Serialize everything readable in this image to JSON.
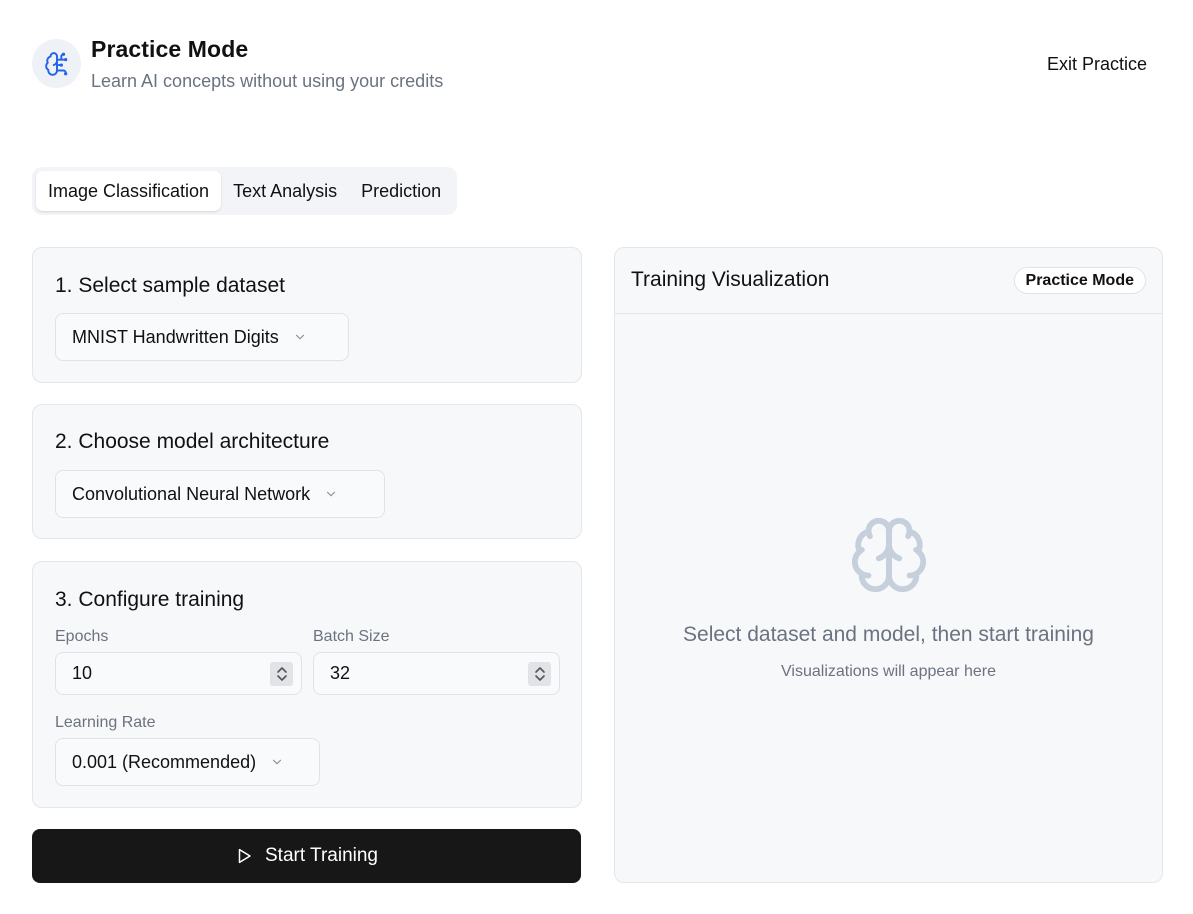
{
  "header": {
    "title": "Practice Mode",
    "subtitle": "Learn AI concepts without using your credits",
    "exit_label": "Exit Practice",
    "logo_icon": "brain-circuit-icon"
  },
  "tabs": [
    {
      "label": "Image Classification",
      "active": true
    },
    {
      "label": "Text Analysis",
      "active": false
    },
    {
      "label": "Prediction",
      "active": false
    }
  ],
  "dataset": {
    "title": "1. Select sample dataset",
    "selected": "MNIST Handwritten Digits"
  },
  "model": {
    "title": "2. Choose model architecture",
    "selected": "Convolutional Neural Network"
  },
  "training": {
    "title": "3. Configure training",
    "epochs_label": "Epochs",
    "epochs_value": "10",
    "batch_label": "Batch Size",
    "batch_value": "32",
    "lr_label": "Learning Rate",
    "lr_selected": "0.001 (Recommended)"
  },
  "start_button": {
    "label": "Start Training",
    "icon": "play-icon"
  },
  "visualization": {
    "title": "Training Visualization",
    "badge": "Practice Mode",
    "empty_icon": "brain-icon",
    "empty_title": "Select dataset and model, then start training",
    "empty_subtitle": "Visualizations will appear here"
  },
  "colors": {
    "accent": "#2563eb",
    "button_bg": "#171717",
    "muted_text": "#6b7280",
    "empty_icon": "#c5d0dc"
  }
}
